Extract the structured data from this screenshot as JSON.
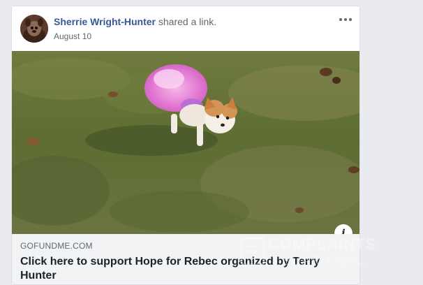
{
  "post": {
    "author": "Sherrie Wright-Hunter",
    "action": "shared a link.",
    "date": "August 10"
  },
  "link": {
    "domain": "GOFUNDME.COM",
    "title": "Click here to support Hope for Rebec organized by Terry Hunter"
  },
  "icons": {
    "more": "more-options-icon",
    "info": "info-icon"
  },
  "watermark": {
    "title": "COMPLAINTS",
    "board": "BOARD",
    "tagline": "SOLVING",
    "since": "SINCE 2003"
  },
  "colors": {
    "author_link": "#385898",
    "page_background": "#e9ebee",
    "link_meta_background": "#f2f3f5"
  }
}
